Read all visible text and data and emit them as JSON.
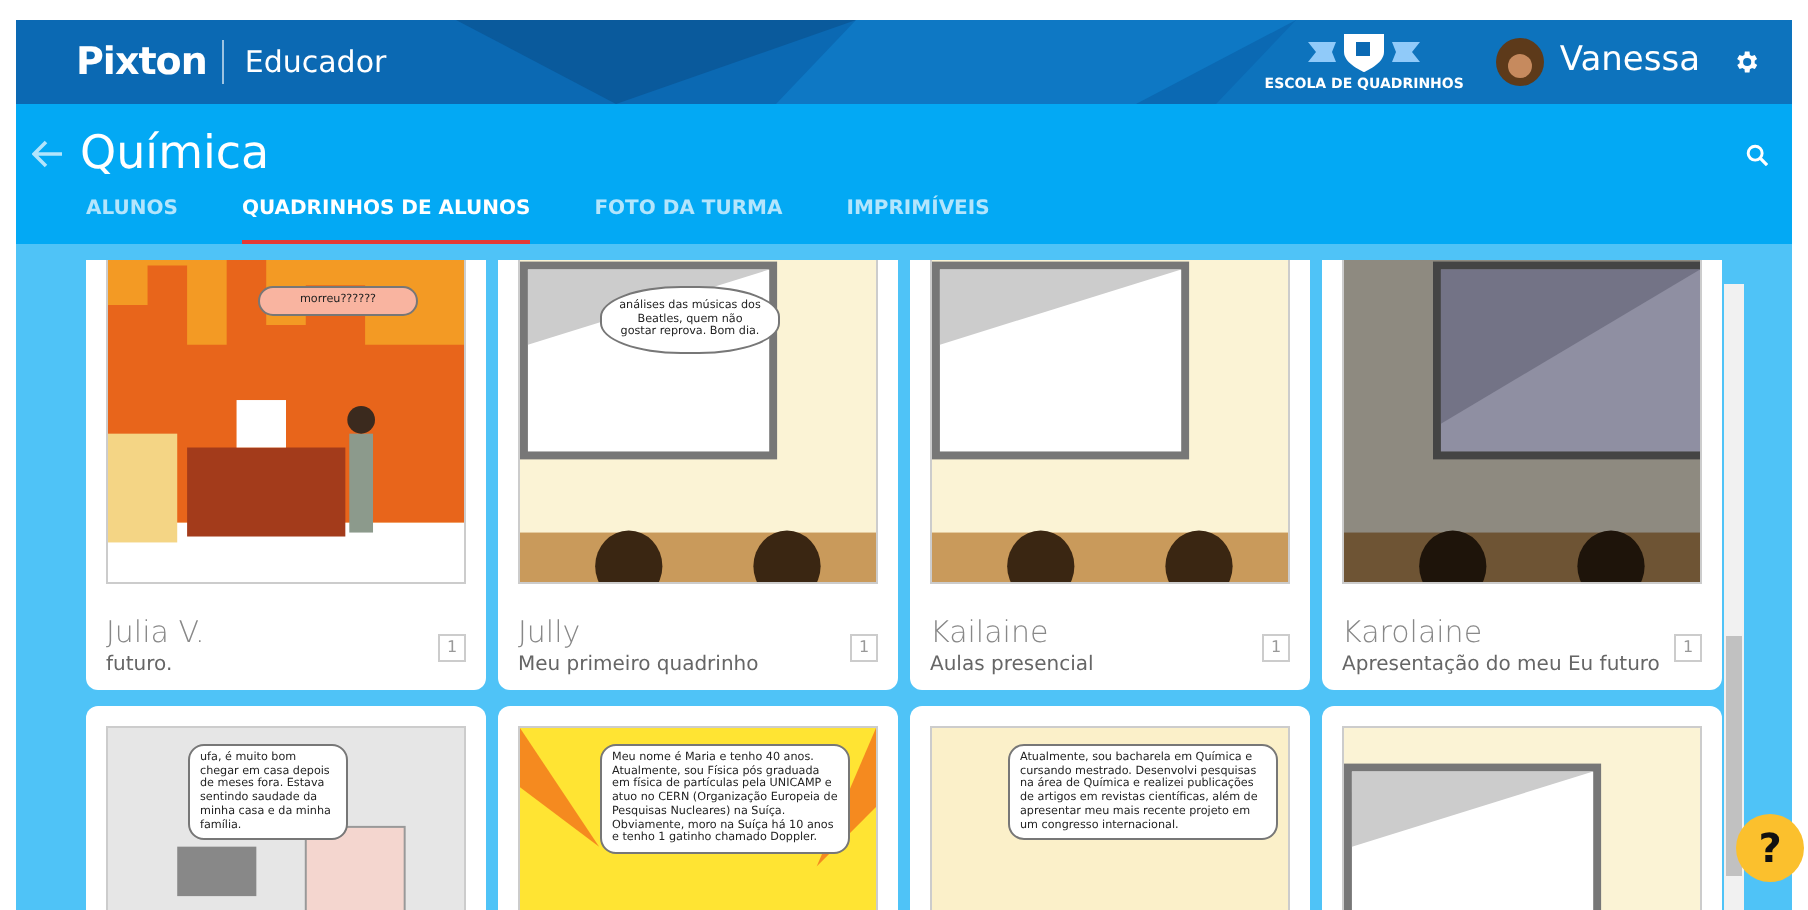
{
  "header": {
    "logo": "Pixton",
    "product": "Educador",
    "badge": "ESCOLA DE QUADRINHOS",
    "user": "Vanessa"
  },
  "class_bar": {
    "title": "Química"
  },
  "tabs": [
    {
      "label": "ALUNOS",
      "selected": false
    },
    {
      "label": "QUADRINHOS DE ALUNOS",
      "selected": true
    },
    {
      "label": "FOTO DA TURMA",
      "selected": false
    },
    {
      "label": "IMPRIMÍVEIS",
      "selected": false
    }
  ],
  "comics": [
    {
      "kind": "office",
      "bubble": "morreu??????",
      "student": "Julia V.",
      "title": "futuro.",
      "count": "1"
    },
    {
      "kind": "classroom",
      "bubble": "análises das músicas dos Beatles, quem não gostar reprova. Bom dia.",
      "student": "Jully",
      "title": "Meu primeiro quadrinho",
      "count": "1"
    },
    {
      "kind": "classroom",
      "student": "Kailaine",
      "title": "Aulas presencial",
      "count": "1"
    },
    {
      "kind": "dim",
      "student": "Karolaine",
      "title": "Apresentação do meu Eu futuro",
      "count": "1"
    },
    {
      "kind": "room",
      "bubble": "ufa, é muito bom chegar em casa depois de meses fora. Estava sentindo saudade da minha casa e da minha família."
    },
    {
      "kind": "burst",
      "bubble": "Meu nome é Maria e tenho 40 anos. Atualmente, sou Física pós graduada em física de partículas pela UNICAMP e atuo no CERN (Organização Europeia de Pesquisas Nucleares) na Suíça. Obviamente, moro na Suíça há 10 anos e tenho 1 gatinho chamado Doppler."
    },
    {
      "kind": "portrait",
      "bubble": "Atualmente, sou bacharela em Química e cursando mestrado. Desenvolvi pesquisas na área de Química e realizei publicações de artigos em revistas científicas, além de apresentar meu mais recente projeto em um congresso internacional."
    },
    {
      "kind": "classroom"
    }
  ],
  "help_button": "?"
}
